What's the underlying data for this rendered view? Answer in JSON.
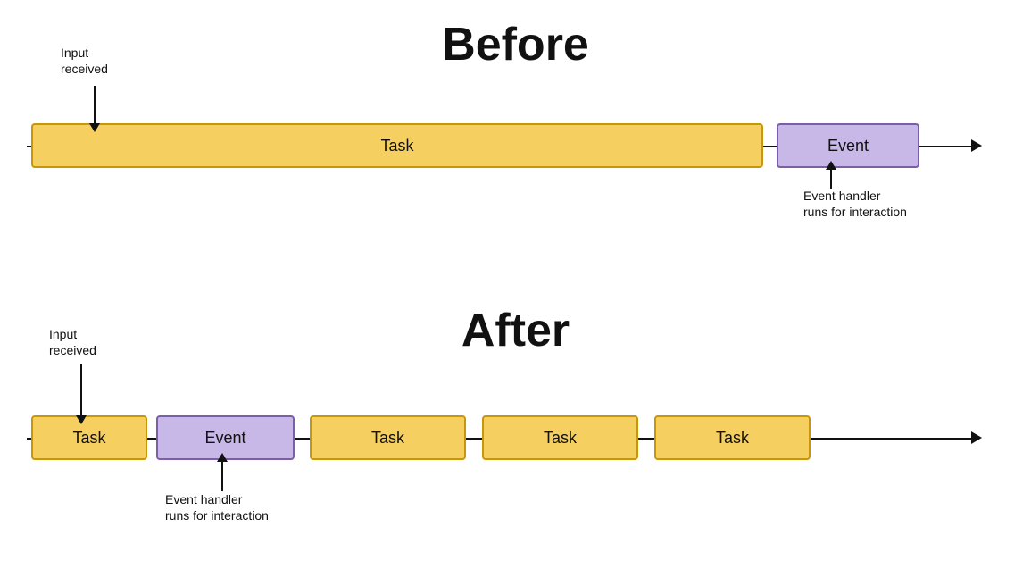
{
  "before": {
    "title": "Before",
    "input_label": "Input\nreceived",
    "event_handler_label": "Event handler\nruns for interaction",
    "task_label": "Task",
    "event_label": "Event"
  },
  "after": {
    "title": "After",
    "input_label": "Input\nreceived",
    "event_handler_label": "Event handler\nruns for interaction",
    "task_label": "Task",
    "event_label": "Event",
    "task2_label": "Task",
    "task3_label": "Task",
    "task4_label": "Task"
  }
}
